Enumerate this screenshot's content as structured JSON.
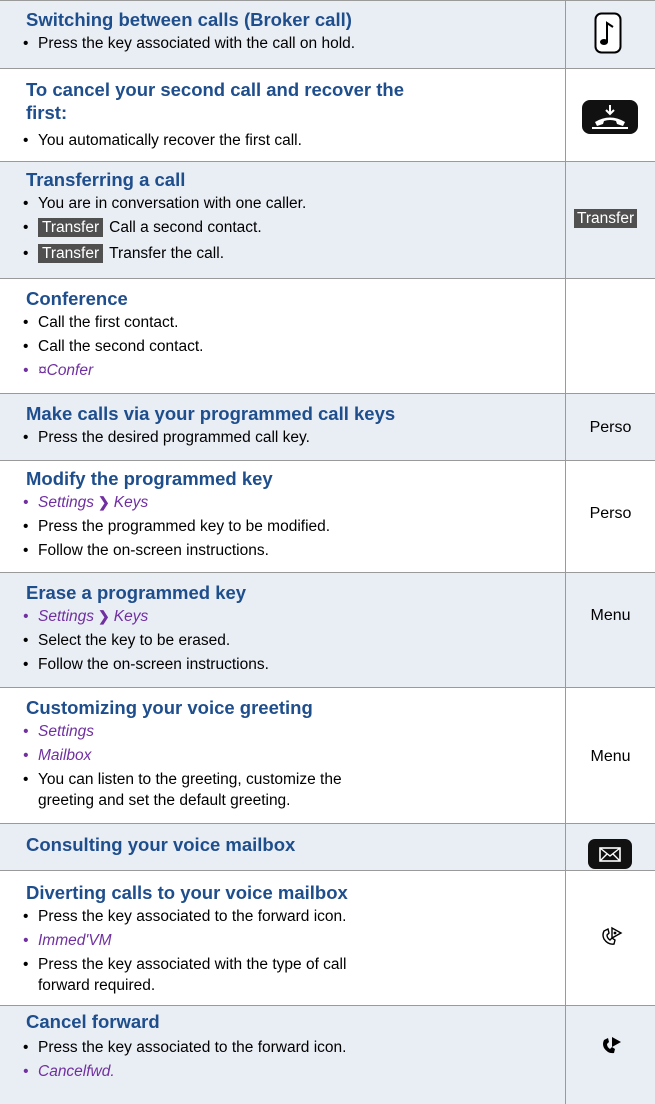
{
  "rows": [
    {
      "title": "Switching between calls (Broker call)",
      "items": [
        "Press the key associated with the call on hold."
      ],
      "icon": "music-note-icon"
    },
    {
      "title_line1": "To cancel your second call and recover the",
      "title_line2": "first:",
      "items": [
        "You automatically recover the first call."
      ],
      "icon": "hang-up-icon"
    },
    {
      "title": "Transferring a call",
      "items": [
        "You are in conversation with one caller.",
        "Call a second contact.",
        "Transfer the call."
      ],
      "softkey": "Transfer",
      "key": "Transfer"
    },
    {
      "title": "Conference",
      "items": [
        "Call the first contact.",
        "Call the second contact.",
        "¤Confer"
      ]
    },
    {
      "title": "Make calls via your programmed call keys",
      "items": [
        "Press the desired programmed call key."
      ],
      "key": "Perso"
    },
    {
      "title": "Modify the programmed key",
      "nav": [
        "Settings",
        "Keys"
      ],
      "items": [
        "Press the programmed key to be modified.",
        "Follow the on-screen instructions."
      ],
      "key": "Perso"
    },
    {
      "title": "Erase a programmed key",
      "nav": [
        "Settings",
        "Keys"
      ],
      "items": [
        "Select the key to be erased.",
        "Follow the on-screen instructions."
      ],
      "key": "Menu"
    },
    {
      "title": "Customizing your voice greeting",
      "items": [
        "Settings",
        "Mailbox",
        "You can listen to the greeting, customize the",
        "greeting and set the default greeting."
      ],
      "key": "Menu"
    },
    {
      "title": "Consulting your voice mailbox",
      "icon": "envelope-icon"
    },
    {
      "title": "Diverting calls to your voice mailbox",
      "items": [
        "Press the key associated to the forward icon.",
        "Immed'VM",
        "Press the key associated with the type of call",
        "forward required."
      ],
      "icon": "forward-icon"
    },
    {
      "title": "Cancel forward",
      "items": [
        "Press the key associated to the forward icon.",
        "Cancelfwd."
      ],
      "icon": "forward-filled-icon"
    }
  ],
  "colors": {
    "heading": "#1f4e8c",
    "menu_item": "#7030a0",
    "shade": "#e9edf4",
    "softkey_bg": "#505050"
  }
}
